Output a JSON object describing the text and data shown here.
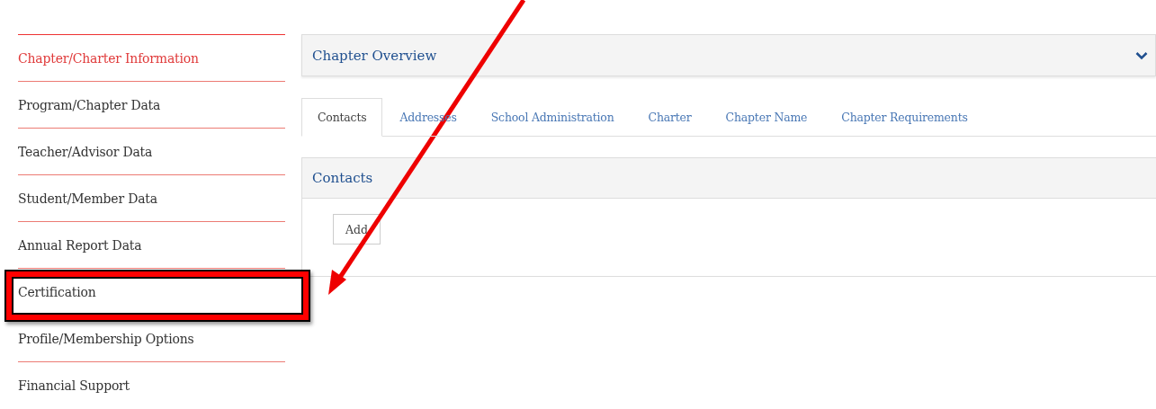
{
  "sidebar": {
    "items": [
      {
        "label": "Chapter/Charter Information",
        "selected": true,
        "highlighted": false
      },
      {
        "label": "Program/Chapter Data",
        "selected": false,
        "highlighted": false
      },
      {
        "label": "Teacher/Advisor Data",
        "selected": false,
        "highlighted": false
      },
      {
        "label": "Student/Member Data",
        "selected": false,
        "highlighted": false
      },
      {
        "label": "Annual Report Data",
        "selected": false,
        "highlighted": false
      },
      {
        "label": "Certification",
        "selected": false,
        "highlighted": true
      },
      {
        "label": "Profile/Membership Options",
        "selected": false,
        "highlighted": false
      },
      {
        "label": "Financial Support",
        "selected": false,
        "highlighted": false
      }
    ]
  },
  "overview": {
    "title": "Chapter Overview",
    "expanded": false
  },
  "tabs": [
    {
      "label": "Contacts",
      "selected": true
    },
    {
      "label": "Addresses",
      "selected": false
    },
    {
      "label": "School Administration",
      "selected": false
    },
    {
      "label": "Charter",
      "selected": false
    },
    {
      "label": "Chapter Name",
      "selected": false
    },
    {
      "label": "Chapter Requirements",
      "selected": false
    }
  ],
  "contacts_panel": {
    "title": "Contacts",
    "button": "Add"
  }
}
